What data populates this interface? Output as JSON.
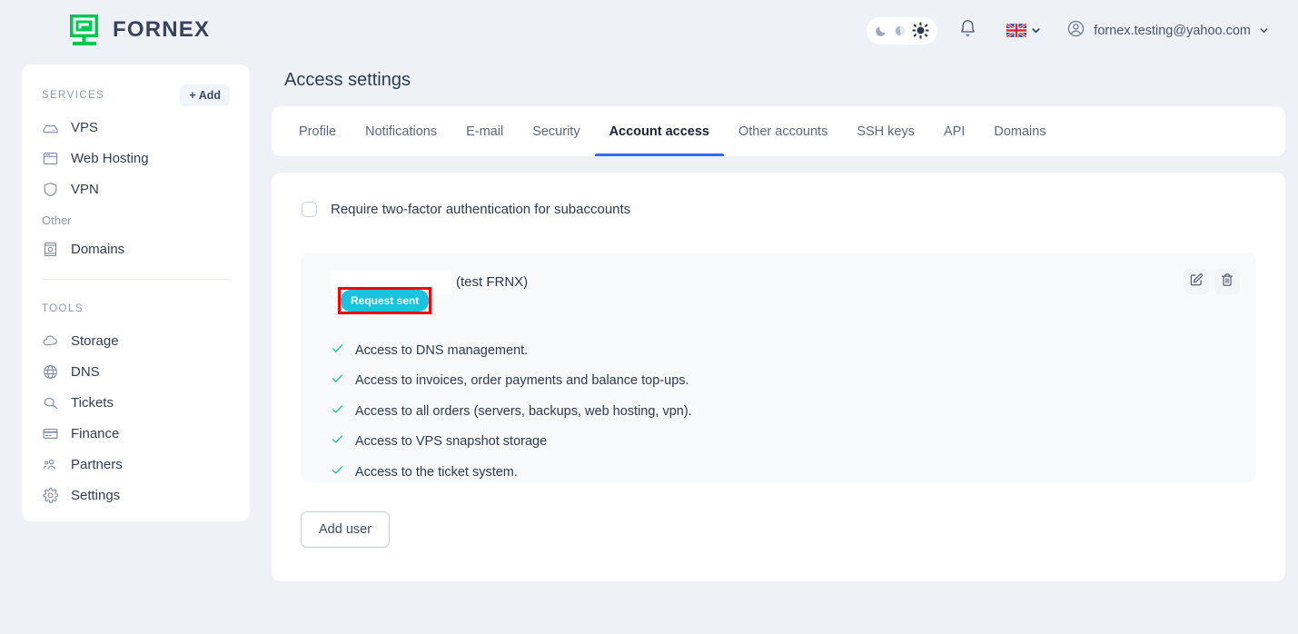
{
  "brand": {
    "name": "FORNEX",
    "logo_icon": "fornex-monitor-logo",
    "color": "#00c853"
  },
  "topbar": {
    "theme_switch": {
      "moon_icon": "moon-icon",
      "auto_icon": "half-moon-auto-icon",
      "sun_icon": "sun-icon",
      "active": "sun"
    },
    "notifications_icon": "bell-icon",
    "language": {
      "flag": "uk-flag-icon",
      "chevron": "chevron-down-icon"
    },
    "user": {
      "avatar_icon": "user-circle-icon",
      "email": "fornex.testing@yahoo.com",
      "chevron": "chevron-down-icon"
    }
  },
  "sidebar": {
    "services": {
      "label": "SERVICES",
      "add_label": "+ Add",
      "items": [
        {
          "label": "VPS",
          "icon": "server-icon"
        },
        {
          "label": "Web Hosting",
          "icon": "browser-window-icon"
        },
        {
          "label": "VPN",
          "icon": "shield-icon"
        }
      ]
    },
    "other": {
      "label": "Other",
      "items": [
        {
          "label": "Domains",
          "icon": "book-icon"
        }
      ]
    },
    "tools": {
      "label": "TOOLS",
      "items": [
        {
          "label": "Storage",
          "icon": "cloud-icon"
        },
        {
          "label": "DNS",
          "icon": "globe-icon"
        },
        {
          "label": "Tickets",
          "icon": "chat-bubbles-icon"
        },
        {
          "label": "Finance",
          "icon": "credit-card-icon"
        },
        {
          "label": "Partners",
          "icon": "people-icon"
        },
        {
          "label": "Settings",
          "icon": "gear-icon"
        }
      ]
    }
  },
  "main": {
    "page_title": "Access settings",
    "tabs": [
      {
        "label": "Profile",
        "active": false
      },
      {
        "label": "Notifications",
        "active": false
      },
      {
        "label": "E-mail",
        "active": false
      },
      {
        "label": "Security",
        "active": false
      },
      {
        "label": "Account access",
        "active": true
      },
      {
        "label": "Other accounts",
        "active": false
      },
      {
        "label": "SSH keys",
        "active": false
      },
      {
        "label": "API",
        "active": false
      },
      {
        "label": "Domains",
        "active": false
      }
    ],
    "active_tab_color": "#2f6df6",
    "two_factor": {
      "label": "Require two-factor authentication for subaccounts",
      "checked": false
    },
    "user_card": {
      "email_redacted": true,
      "name_suffix": "(test FRNX)",
      "status_badge": {
        "label": "Request sent",
        "bg_color": "#1bc2dd",
        "text_color": "#ffffff",
        "highlight_color": "#ff0000"
      },
      "edit_icon": "edit-pencil-icon",
      "delete_icon": "trash-icon",
      "permissions": [
        "Access to DNS management.",
        "Access to invoices, order payments and balance top-ups.",
        "Access to all orders (servers, backups, web hosting, vpn).",
        "Access to VPS snapshot storage",
        "Access to the ticket system."
      ],
      "check_icon": "check-icon",
      "check_color": "#2fc48d"
    },
    "add_user_label": "Add user"
  }
}
